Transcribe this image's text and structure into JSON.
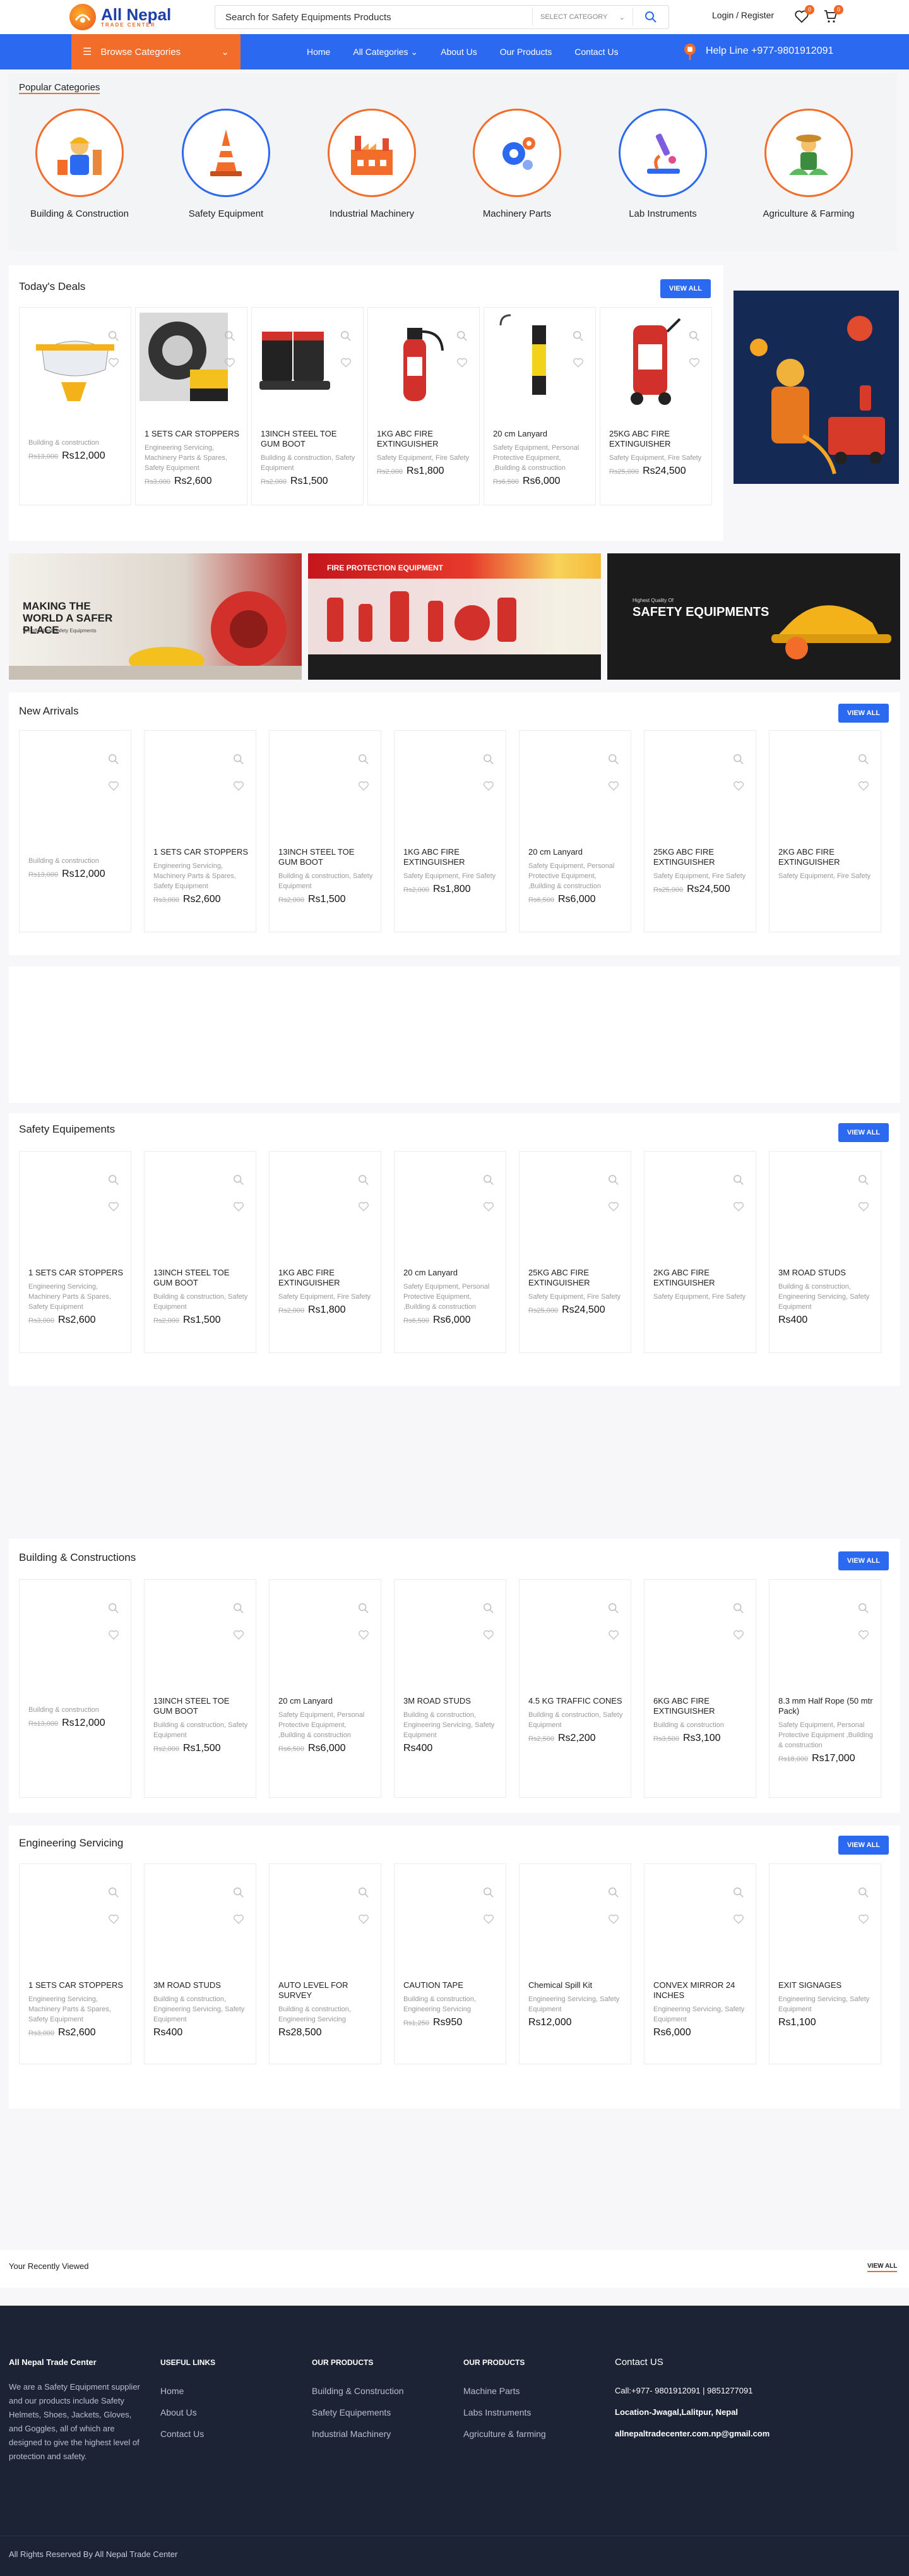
{
  "brand": {
    "name": "All Nepal",
    "tagline": "TRADE CENTER"
  },
  "search": {
    "placeholder": "Search for Safety Equipments Products",
    "category": "SELECT CATEGORY"
  },
  "account": {
    "label": "Login / Register",
    "wishlist_count": "0",
    "cart_count": "0"
  },
  "nav": {
    "browse": "Browse Categories",
    "links": [
      "Home",
      "All Categories",
      "About Us",
      "Our Products",
      "Contact Us"
    ],
    "helpline": "Help Line +977-9801912091"
  },
  "popular": {
    "title": "Popular Categories",
    "items": [
      {
        "name": "Building & Construction",
        "icon": "builder-icon"
      },
      {
        "name": "Safety Equipment",
        "icon": "traffic-cone-icon"
      },
      {
        "name": "Industrial Machinery",
        "icon": "factory-icon"
      },
      {
        "name": "Machinery Parts",
        "icon": "gears-icon"
      },
      {
        "name": "Lab Instruments",
        "icon": "microscope-icon"
      },
      {
        "name": "Agriculture & Farming",
        "icon": "farmer-icon"
      }
    ]
  },
  "deals": {
    "title": "Today's Deals",
    "view_all": "VIEW ALL",
    "items": [
      {
        "title": "",
        "cats": "Building & construction",
        "old": "Rs13,000",
        "price": "Rs12,000",
        "img": "safety-goggles"
      },
      {
        "title": "1 SETS CAR STOPPERS",
        "cats": "Engineering Servicing, Machinery Parts & Spares, Safety Equipment",
        "old": "Rs3,000",
        "price": "Rs2,600",
        "img": "car-stopper"
      },
      {
        "title": "13INCH STEEL TOE GUM BOOT",
        "cats": "Building & construction, Safety Equipment",
        "old": "Rs2,000",
        "price": "Rs1,500",
        "img": "gum-boot"
      },
      {
        "title": "1KG ABC FIRE EXTINGUISHER",
        "cats": "Safety Equipment, Fire Safety",
        "old": "Rs2,000",
        "price": "Rs1,800",
        "img": "extinguisher"
      },
      {
        "title": "20 cm Lanyard",
        "cats": "Safety Equipment, Personal Protective Equipment, ,Building & construction",
        "old": "Rs6,500",
        "price": "Rs6,000",
        "img": "lanyard"
      },
      {
        "title": "25KG ABC FIRE EXTINGUISHER",
        "cats": "Safety Equipment, Fire Safety",
        "old": "Rs25,000",
        "price": "Rs24,500",
        "img": "trolley-extinguisher"
      }
    ]
  },
  "banners": [
    {
      "text": "MAKING THE WORLD A SAFER PLACE",
      "sub": "We offer best Safety Equipments"
    },
    {
      "text": "FIRE PROTECTION EQUIPMENT",
      "sub": ""
    },
    {
      "text": "SAFETY EQUIPMENTS",
      "sub": "Highest Quality Of"
    }
  ],
  "arrivals": {
    "title": "New Arrivals",
    "view_all": "VIEW ALL",
    "items": [
      {
        "title": "",
        "cats": "Building & construction",
        "old": "Rs13,000",
        "price": "Rs12,000"
      },
      {
        "title": "1 SETS CAR STOPPERS",
        "cats": "Engineering Servicing, Machinery Parts & Spares, Safety Equipment",
        "old": "Rs3,000",
        "price": "Rs2,600"
      },
      {
        "title": "13INCH STEEL TOE GUM BOOT",
        "cats": "Building & construction, Safety Equipment",
        "old": "Rs2,000",
        "price": "Rs1,500"
      },
      {
        "title": "1KG ABC FIRE EXTINGUISHER",
        "cats": "Safety Equipment, Fire Safety",
        "old": "Rs2,000",
        "price": "Rs1,800"
      },
      {
        "title": "20 cm Lanyard",
        "cats": "Safety Equipment, Personal Protective Equipment, ,Building & construction",
        "old": "Rs6,500",
        "price": "Rs6,000"
      },
      {
        "title": "25KG ABC FIRE EXTINGUISHER",
        "cats": "Safety Equipment, Fire Safety",
        "old": "Rs25,000",
        "price": "Rs24,500"
      },
      {
        "title": "2KG ABC FIRE EXTINGUISHER",
        "cats": "Safety Equipment, Fire Safety",
        "old": "",
        "price": ""
      }
    ]
  },
  "safety": {
    "title": "Safety Equipements",
    "view_all": "VIEW ALL",
    "items": [
      {
        "title": "1 SETS CAR STOPPERS",
        "cats": "Engineering Servicing, Machinery Parts & Spares, Safety Equipment",
        "old": "Rs3,000",
        "price": "Rs2,600"
      },
      {
        "title": "13INCH STEEL TOE GUM BOOT",
        "cats": "Building & construction, Safety Equipment",
        "old": "Rs2,000",
        "price": "Rs1,500"
      },
      {
        "title": "1KG ABC FIRE EXTINGUISHER",
        "cats": "Safety Equipment, Fire Safety",
        "old": "Rs2,000",
        "price": "Rs1,800"
      },
      {
        "title": "20 cm Lanyard",
        "cats": "Safety Equipment, Personal Protective Equipment, ,Building & construction",
        "old": "Rs6,500",
        "price": "Rs6,000"
      },
      {
        "title": "25KG ABC FIRE EXTINGUISHER",
        "cats": "Safety Equipment, Fire Safety",
        "old": "Rs25,000",
        "price": "Rs24,500"
      },
      {
        "title": "2KG ABC FIRE EXTINGUISHER",
        "cats": "Safety Equipment, Fire Safety",
        "old": "",
        "price": ""
      },
      {
        "title": "3M ROAD STUDS",
        "cats": "Building & construction, Engineering Servicing, Safety Equipment",
        "old": "",
        "price": "Rs400"
      }
    ]
  },
  "building": {
    "title": "Building & Constructions",
    "view_all": "VIEW ALL",
    "items": [
      {
        "title": "",
        "cats": "Building & construction",
        "old": "Rs13,000",
        "price": "Rs12,000"
      },
      {
        "title": "13INCH STEEL TOE GUM BOOT",
        "cats": "Building & construction, Safety Equipment",
        "old": "Rs2,000",
        "price": "Rs1,500"
      },
      {
        "title": "20 cm Lanyard",
        "cats": "Safety Equipment, Personal Protective Equipment, ,Building & construction",
        "old": "Rs6,500",
        "price": "Rs6,000"
      },
      {
        "title": "3M ROAD STUDS",
        "cats": "Building & construction, Engineering Servicing, Safety Equipment",
        "old": "",
        "price": "Rs400"
      },
      {
        "title": "4.5 KG TRAFFIC CONES",
        "cats": "Building & construction, Safety Equipment",
        "old": "Rs2,500",
        "price": "Rs2,200"
      },
      {
        "title": "6KG ABC FIRE EXTINGUISHER",
        "cats": "Building & construction",
        "old": "Rs3,500",
        "price": "Rs3,100"
      },
      {
        "title": "8.3 mm Half Rope (50 mtr Pack)",
        "cats": "Safety Equipment, Personal Protective Equipment ,Building & construction",
        "old": "Rs18,000",
        "price": "Rs17,000"
      }
    ]
  },
  "engineering": {
    "title": "Engineering Servicing",
    "view_all": "VIEW ALL",
    "items": [
      {
        "title": "1 SETS CAR STOPPERS",
        "cats": "Engineering Servicing, Machinery Parts & Spares, Safety Equipment",
        "old": "Rs3,000",
        "price": "Rs2,600"
      },
      {
        "title": "3M ROAD STUDS",
        "cats": "Building & construction, Engineering Servicing, Safety Equipment",
        "old": "",
        "price": "Rs400"
      },
      {
        "title": "AUTO LEVEL FOR SURVEY",
        "cats": "Building & construction, Engineering Servicing",
        "old": "",
        "price": "Rs28,500"
      },
      {
        "title": "CAUTION TAPE",
        "cats": "Building & construction, Engineering Servicing",
        "old": "Rs1,250",
        "price": "Rs950"
      },
      {
        "title": "Chemical Spill Kit",
        "cats": "Engineering Servicing, Safety Equipment",
        "old": "",
        "price": "Rs12,000"
      },
      {
        "title": "CONVEX MIRROR 24 INCHES",
        "cats": "Engineering Servicing, Safety Equipment",
        "old": "",
        "price": "Rs6,000"
      },
      {
        "title": "EXIT SIGNAGES",
        "cats": "Engineering Servicing, Safety Equipment",
        "old": "",
        "price": "Rs1,100"
      }
    ]
  },
  "recent": {
    "title": "Your Recently Viewed",
    "view_all": "VIEW ALL"
  },
  "footer": {
    "about_title": "All Nepal Trade Center",
    "about_text": "We are a Safety Equipment supplier and our products include Safety Helmets, Shoes, Jackets, Gloves, and Goggles, all of which are designed to give the highest level of protection and safety.",
    "useful_title": "USEFUL LINKS",
    "useful": [
      "Home",
      "About Us",
      "Contact Us"
    ],
    "prod1_title": "OUR PRODUCTS",
    "prod1": [
      "Building & Construction",
      "Safety Equipements",
      "Industrial Machinery"
    ],
    "prod2_title": "OUR PRODUCTS",
    "prod2": [
      "Machine Parts",
      "Labs Instruments",
      "Agriculture & farming"
    ],
    "contact_title": "Contact US",
    "phone": "Call:+977- 9801912091 | 9851277091",
    "location": "Location-Jwagal,Lalitpur, Nepal",
    "email": "allnepaltradecenter.com.np@gmail.com",
    "copyright": "All Rights Reserved By All Nepal Trade Center"
  },
  "colors": {
    "primary": "#2c69f1",
    "accent": "#f26c2a",
    "footer": "#1c2335"
  }
}
